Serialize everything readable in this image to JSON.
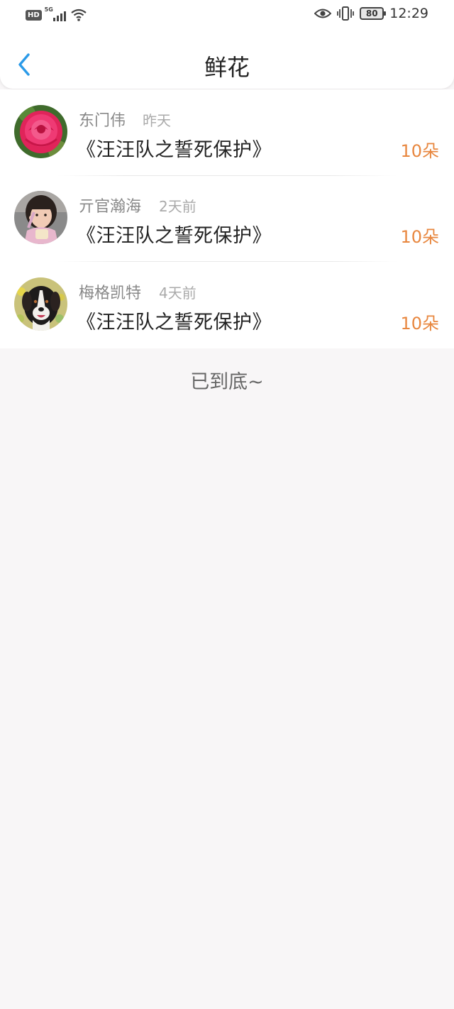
{
  "status_bar": {
    "hd": "HD",
    "network": "5G",
    "battery": "80",
    "time": "12:29"
  },
  "header": {
    "title": "鲜花"
  },
  "items": [
    {
      "name": "东门伟",
      "time": "昨天",
      "book": "《汪汪队之誓死保护》",
      "count": "10朵",
      "avatar": "rose"
    },
    {
      "name": "亓官瀚海",
      "time": "2天前",
      "book": "《汪汪队之誓死保护》",
      "count": "10朵",
      "avatar": "girl"
    },
    {
      "name": "梅格凯特",
      "time": "4天前",
      "book": "《汪汪队之誓死保护》",
      "count": "10朵",
      "avatar": "dog"
    }
  ],
  "footer": {
    "end_text": "已到底~"
  },
  "colors": {
    "accent_back": "#2a9ae8",
    "count": "#e8873f"
  }
}
